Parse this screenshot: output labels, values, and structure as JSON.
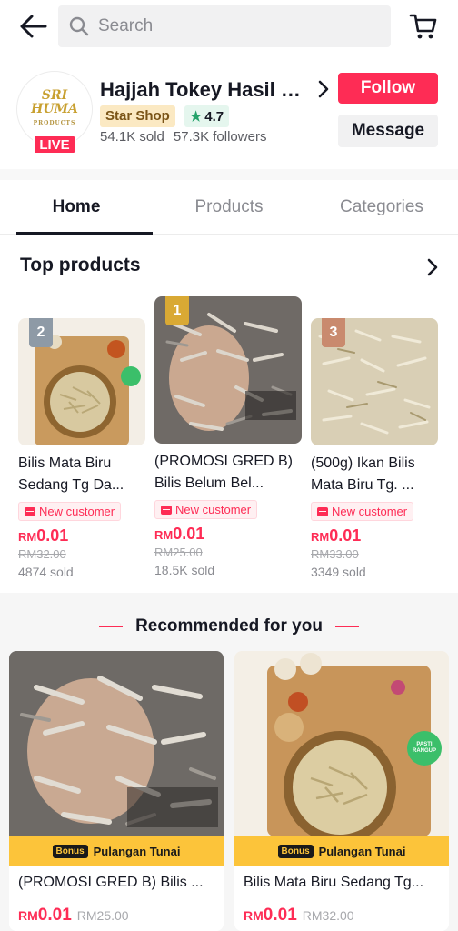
{
  "search": {
    "placeholder": "Search"
  },
  "shop": {
    "logo_text": "SRI HUMA",
    "logo_sub": "PRODUCTS",
    "live_label": "LIVE",
    "name": "Hajjah Tokey Hasil L...",
    "star_shop": "Star Shop",
    "rating": "4.7",
    "sold": "54.1K sold",
    "followers": "57.3K followers",
    "follow_label": "Follow",
    "message_label": "Message"
  },
  "tabs": [
    {
      "label": "Home",
      "active": true
    },
    {
      "label": "Products",
      "active": false
    },
    {
      "label": "Categories",
      "active": false
    }
  ],
  "top_products": {
    "title": "Top products",
    "items": [
      {
        "rank": "2",
        "title": "Bilis Mata Biru Sedang Tg Da...",
        "badge": "New customer",
        "currency": "RM",
        "price": "0.01",
        "old_price": "RM32.00",
        "sold": "4874 sold",
        "rank_color": "#8e9aa6"
      },
      {
        "rank": "1",
        "title": "(PROMOSI GRED B) Bilis Belum Bel...",
        "badge": "New customer",
        "currency": "RM",
        "price": "0.01",
        "old_price": "RM25.00",
        "sold": "18.5K sold",
        "rank_color": "#d9a934"
      },
      {
        "rank": "3",
        "title": "(500g) Ikan Bilis Mata Biru Tg. ...",
        "badge": "New customer",
        "currency": "RM",
        "price": "0.01",
        "old_price": "RM33.00",
        "sold": "3349 sold",
        "rank_color": "#c98a6e"
      }
    ]
  },
  "recommended": {
    "title": "Recommended for you",
    "items": [
      {
        "bonus_tag": "Bonus",
        "bonus_text": "Pulangan Tunai",
        "title": "(PROMOSI GRED B) Bilis ...",
        "currency": "RM",
        "price": "0.01",
        "old_price": "RM25.00"
      },
      {
        "bonus_tag": "Bonus",
        "bonus_text": "Pulangan Tunai",
        "title": "Bilis Mata Biru Sedang Tg...",
        "currency": "RM",
        "price": "0.01",
        "old_price": "RM32.00",
        "sticker": "PASTI RANGUP"
      }
    ]
  },
  "colors": {
    "accent": "#fe2c55",
    "star_green": "#25a26a",
    "bonus_yellow": "#fcc43a"
  }
}
